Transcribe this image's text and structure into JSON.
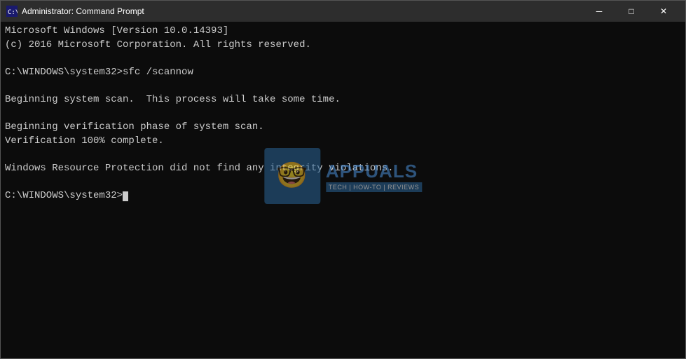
{
  "window": {
    "title": "Administrator: Command Prompt",
    "icon": "cmd-icon"
  },
  "titlebar": {
    "minimize_label": "─",
    "maximize_label": "□",
    "close_label": "✕"
  },
  "console": {
    "lines": [
      "Microsoft Windows [Version 10.0.14393]",
      "(c) 2016 Microsoft Corporation. All rights reserved.",
      "",
      "C:\\WINDOWS\\system32>sfc /scannow",
      "",
      "Beginning system scan.  This process will take some time.",
      "",
      "Beginning verification phase of system scan.",
      "Verification 100% complete.",
      "",
      "Windows Resource Protection did not find any integrity violations.",
      "",
      "C:\\WINDOWS\\system32>"
    ]
  },
  "watermark": {
    "brand": "APPUALS",
    "tagline": "TECH | HOW-TO | REVIEWS"
  }
}
